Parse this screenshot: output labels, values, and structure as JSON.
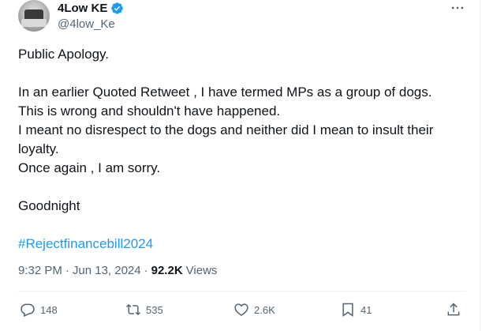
{
  "author": {
    "name": "4Low KE",
    "handle": "@4low_Ke",
    "verified_color": "#1d9bf0"
  },
  "tweet": {
    "paragraphs": [
      [
        "Public Apology."
      ],
      [
        "In an earlier Quoted Retweet  , I have termed MPs as a group of dogs.",
        "This is wrong and shouldn't have happened.",
        "I meant no disrespect to the dogs and neither did I mean to insult their",
        "loyalty.",
        "Once again , I am sorry."
      ],
      [
        "Goodnight"
      ]
    ],
    "hashtag": "#Rejectfinancebill2024",
    "time": "9:32 PM",
    "date": "Jun 13, 2024",
    "views_count": "92.2K",
    "views_label": "Views"
  },
  "actions": {
    "replies": "148",
    "reposts": "535",
    "likes": "2.6K",
    "bookmarks": "41"
  },
  "icons": [
    "more-icon",
    "verified-badge-icon",
    "reply-icon",
    "repost-icon",
    "like-icon",
    "bookmark-icon",
    "share-icon"
  ]
}
